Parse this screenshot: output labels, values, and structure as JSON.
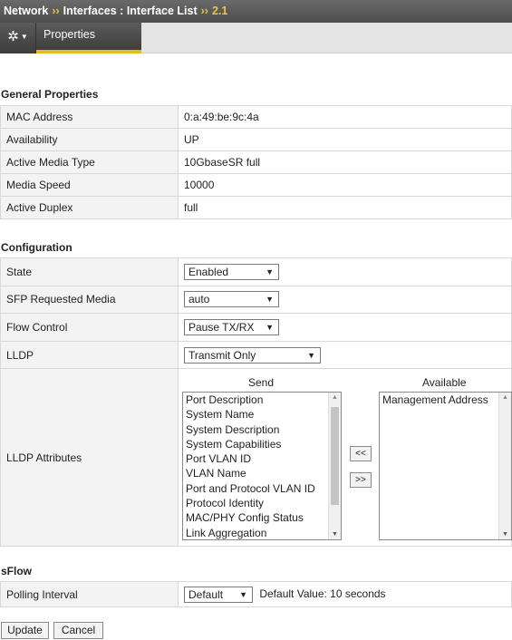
{
  "breadcrumb": {
    "root": "Network",
    "sep1": "››",
    "section": "Interfaces : Interface List",
    "sep2": "››",
    "current": "2.1"
  },
  "tabs": {
    "active": "Properties"
  },
  "general": {
    "title": "General Properties",
    "rows": [
      {
        "label": "MAC Address",
        "value": "0:a:49:be:9c:4a"
      },
      {
        "label": "Availability",
        "value": "UP"
      },
      {
        "label": "Active Media Type",
        "value": "10GbaseSR full"
      },
      {
        "label": "Media Speed",
        "value": "10000"
      },
      {
        "label": "Active Duplex",
        "value": "full"
      }
    ]
  },
  "configuration": {
    "title": "Configuration",
    "state": {
      "label": "State",
      "value": "Enabled"
    },
    "sfp": {
      "label": "SFP Requested Media",
      "value": "auto"
    },
    "flow": {
      "label": "Flow Control",
      "value": "Pause TX/RX"
    },
    "lldp": {
      "label": "LLDP",
      "value": "Transmit Only"
    },
    "lldp_attributes": {
      "label": "LLDP Attributes",
      "send_header": "Send",
      "available_header": "Available",
      "send": [
        "Port Description",
        "System Name",
        "System Description",
        "System Capabilities",
        "Port VLAN ID",
        "VLAN Name",
        "Port and Protocol VLAN ID",
        "Protocol Identity",
        "MAC/PHY Config Status",
        "Link Aggregation"
      ],
      "available": [
        "Management Address"
      ],
      "move_left": "<<",
      "move_right": ">>"
    }
  },
  "sflow": {
    "title": "sFlow",
    "polling": {
      "label": "Polling Interval",
      "value": "Default",
      "note": "Default Value: 10 seconds"
    }
  },
  "buttons": {
    "update": "Update",
    "cancel": "Cancel"
  },
  "icons": {
    "settings": "gear-icon",
    "dropdown": "caret-down-icon"
  }
}
